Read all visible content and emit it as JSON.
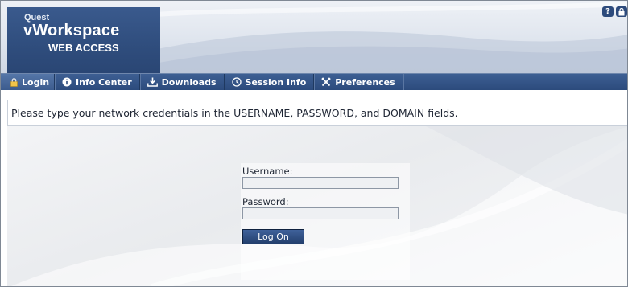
{
  "header": {
    "brand_company": "Quest",
    "brand_product": "vWorkspace",
    "brand_subtitle": "WEB ACCESS",
    "icons": [
      "help-icon",
      "lock-icon"
    ]
  },
  "nav": {
    "tabs": [
      {
        "label": "Login",
        "icon": "lock-icon",
        "active": true
      },
      {
        "label": "Info Center",
        "icon": "info-icon",
        "active": false
      },
      {
        "label": "Downloads",
        "icon": "download-icon",
        "active": false
      },
      {
        "label": "Session Info",
        "icon": "clock-icon",
        "active": false
      },
      {
        "label": "Preferences",
        "icon": "tools-icon",
        "active": false
      }
    ]
  },
  "info_message": "Please type your network credentials in the USERNAME, PASSWORD, and DOMAIN fields.",
  "login": {
    "username_label": "Username:",
    "username_value": "",
    "password_label": "Password:",
    "password_value": "",
    "submit_label": "Log On"
  },
  "colors": {
    "brand_blue": "#2f4d7d",
    "nav_blue": "#2c4b7c",
    "text": "#1e2533"
  }
}
